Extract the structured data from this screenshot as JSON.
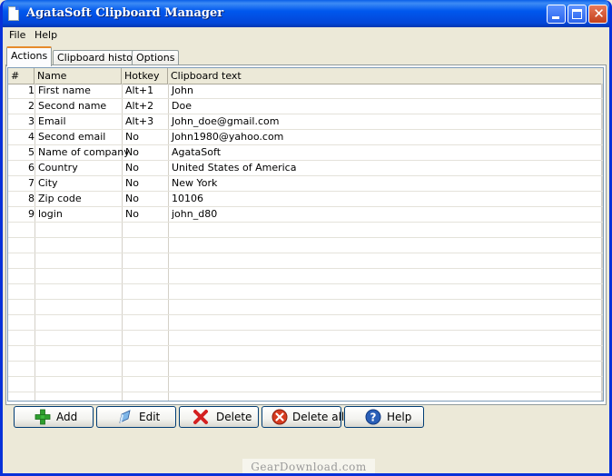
{
  "window": {
    "title": "AgataSoft Clipboard Manager"
  },
  "menu": {
    "file": "File",
    "help": "Help"
  },
  "tabs": [
    {
      "label": "Actions",
      "active": true
    },
    {
      "label": "Clipboard history",
      "active": false
    },
    {
      "label": "Options",
      "active": false
    }
  ],
  "grid": {
    "columns": [
      "#",
      "Name",
      "Hotkey",
      "Clipboard text"
    ],
    "rows": [
      {
        "num": "1",
        "name": "First name",
        "hotkey": "Alt+1",
        "text": "John"
      },
      {
        "num": "2",
        "name": "Second name",
        "hotkey": "Alt+2",
        "text": "Doe"
      },
      {
        "num": "3",
        "name": "Email",
        "hotkey": "Alt+3",
        "text": "John_doe@gmail.com"
      },
      {
        "num": "4",
        "name": "Second email",
        "hotkey": "No",
        "text": "John1980@yahoo.com"
      },
      {
        "num": "5",
        "name": "Name of company",
        "hotkey": "No",
        "text": "AgataSoft"
      },
      {
        "num": "6",
        "name": "Country",
        "hotkey": "No",
        "text": "United States of America"
      },
      {
        "num": "7",
        "name": "City",
        "hotkey": "No",
        "text": "New York"
      },
      {
        "num": "8",
        "name": "Zip code",
        "hotkey": "No",
        "text": "10106"
      },
      {
        "num": "9",
        "name": "login",
        "hotkey": "No",
        "text": "john_d80"
      }
    ]
  },
  "buttons": {
    "add": "Add",
    "edit": "Edit",
    "delete": "Delete",
    "delete_all": "Delete all",
    "help": "Help"
  },
  "icons": {
    "add": "plus-icon",
    "edit": "pen-icon",
    "delete": "x-icon",
    "delete_all": "stop-icon",
    "help": "question-icon"
  },
  "colors": {
    "titlebar": "#0058ee",
    "window_frame": "#0831d9",
    "panel_bg": "#ece9d8",
    "tab_highlight": "#e68b2c"
  },
  "watermark": "GearDownload.com"
}
